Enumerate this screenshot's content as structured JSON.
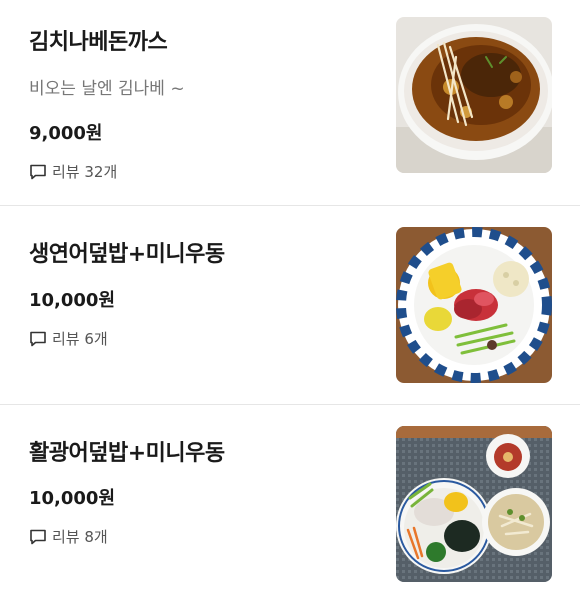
{
  "items": [
    {
      "name": "김치나베돈까스",
      "description": "비오는 날엔 김나베 ~",
      "price": "9,000원",
      "review_label": "리뷰 32개",
      "image_icon": "kimchi-nabe-tonkatsu-photo"
    },
    {
      "name": "생연어덮밥+미니우동",
      "description": "",
      "price": "10,000원",
      "review_label": "리뷰 6개",
      "image_icon": "salmon-rice-bowl-photo"
    },
    {
      "name": "활광어덮밥+미니우동",
      "description": "",
      "price": "10,000원",
      "review_label": "리뷰 8개",
      "image_icon": "flatfish-rice-bowl-photo"
    }
  ]
}
